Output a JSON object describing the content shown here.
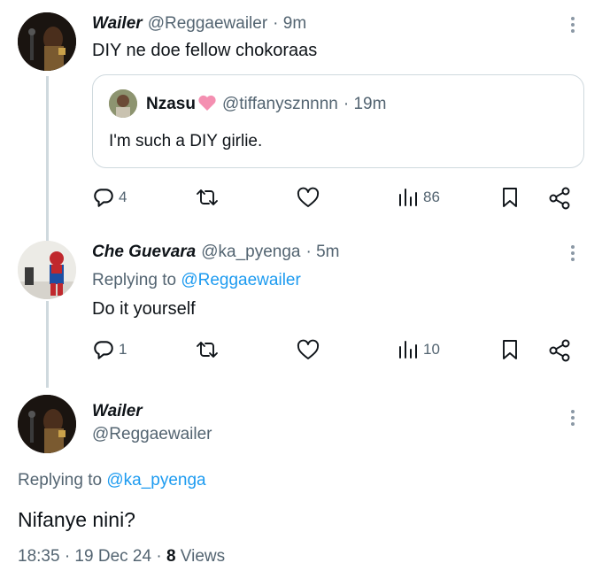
{
  "tweet1": {
    "name": "Wailer",
    "handle": "@Reggaewailer",
    "time": "· 9m",
    "text": "DIY ne doe fellow chokoraas",
    "quote": {
      "name": "Nzasu",
      "handle": "@tiffanysznnnn",
      "time": "· 19m",
      "text": "I'm such a DIY girlie."
    },
    "replies": "4",
    "views": "86"
  },
  "tweet2": {
    "name": "Che Guevara",
    "handle": "@ka_pyenga",
    "time": "· 5m",
    "replying_prefix": "Replying to",
    "replying_to": "@Reggaewailer",
    "text": "Do it yourself",
    "replies": "1",
    "views": "10"
  },
  "tweet3": {
    "name": "Wailer",
    "handle": "@Reggaewailer",
    "replying_prefix": "Replying to",
    "replying_to": "@ka_pyenga",
    "text": "Nifanye nini?",
    "time": "18:35 · 19 Dec 24 ·",
    "views_count": "8",
    "views_label": "Views"
  },
  "colors": {
    "link": "#1d9bf0",
    "muted": "#536471",
    "border": "#cfd9de",
    "heart_emoji": "#f48fb1"
  },
  "icons": [
    "reply-icon",
    "retweet-icon",
    "like-icon",
    "views-icon",
    "bookmark-icon",
    "share-icon",
    "more-icon",
    "heart-emoji-icon"
  ]
}
